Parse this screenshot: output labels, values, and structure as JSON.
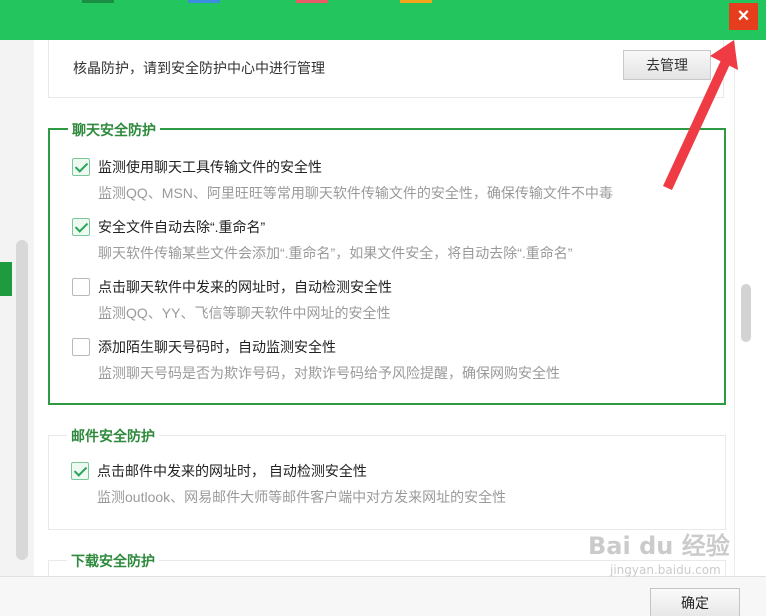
{
  "colors": {
    "title_bar": "#23c55e",
    "close": "#e63d1e",
    "section_accent": "#2e9a43",
    "checkbox_check": "#2aa35b",
    "annotation_arrow": "#ee3b44"
  },
  "window": {
    "close_icon": "×"
  },
  "top_row": {
    "text": "核晶防护，请到安全防护中心中进行管理",
    "button_label": "去管理"
  },
  "sections": {
    "chat": {
      "title": "聊天安全防护",
      "options": [
        {
          "label": "监测使用聊天工具传输文件的安全性",
          "description": "监测QQ、MSN、阿里旺旺等常用聊天软件传输文件的安全性，确保传输文件不中毒",
          "checked": true
        },
        {
          "label": "安全文件自动去除“.重命名”",
          "description": "聊天软件传输某些文件会添加“.重命名”，如果文件安全，将自动去除“.重命名”",
          "checked": true
        },
        {
          "label": "点击聊天软件中发来的网址时，自动检测安全性",
          "description": "监测QQ、YY、飞信等聊天软件中网址的安全性",
          "checked": false
        },
        {
          "label": "添加陌生聊天号码时，自动监测安全性",
          "description": "监测聊天号码是否为欺诈号码，对欺诈号码给予风险提醒，确保网购安全性",
          "checked": false
        }
      ]
    },
    "mail": {
      "title": "邮件安全防护",
      "options": [
        {
          "label": "点击邮件中发来的网址时， 自动检测安全性",
          "description": "监测outlook、网易邮件大师等邮件客户端中对方发来网址的安全性",
          "checked": true
        }
      ]
    },
    "download": {
      "title": "下载安全防护"
    }
  },
  "footer": {
    "ok_label": "确定"
  },
  "watermark": {
    "logo": "Bai du 经验",
    "url": "jingyan.baidu.com"
  }
}
